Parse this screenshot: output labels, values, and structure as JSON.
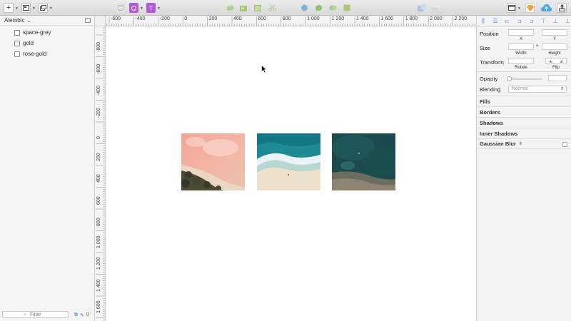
{
  "toolbar": {
    "insert_icon": "plus-icon",
    "group_icon": "artboard-icon",
    "layers_icon": "layers-icon",
    "colors": {
      "accent_purple": "#b05ad6",
      "green": "#9dc26b",
      "blue": "#5fa6d9",
      "sketch_orange": "#f3a33a",
      "cloud_blue": "#4aa8e0"
    }
  },
  "pages": {
    "current": "Alembic",
    "layers": [
      {
        "label": "space-grey"
      },
      {
        "label": "gold"
      },
      {
        "label": "rose-gold"
      }
    ],
    "filter_placeholder": "Filter"
  },
  "ruler": {
    "h_ticks": [
      "-600",
      "-400",
      "-200",
      "0",
      "200",
      "400",
      "600",
      "800",
      "1 000",
      "1 200",
      "1 400",
      "1 600",
      "1 800",
      "2 000",
      "2 200"
    ],
    "v_ticks": [
      "-800",
      "-600",
      "-400",
      "-200",
      "0",
      "200",
      "400",
      "600",
      "800",
      "1 000",
      "1 200",
      "1 400",
      "1 600"
    ]
  },
  "artboards": [
    {
      "name": "rose-gold",
      "theme": "pink"
    },
    {
      "name": "gold",
      "theme": "sand"
    },
    {
      "name": "space-grey",
      "theme": "dark"
    }
  ],
  "inspector": {
    "position_label": "Position",
    "x_label": "X",
    "y_label": "Y",
    "size_label": "Size",
    "width_label": "Width",
    "height_label": "Height",
    "transform_label": "Transform",
    "rotate_label": "Rotate",
    "flip_label": "Flip",
    "opacity_label": "Opacity",
    "blending_label": "Blending",
    "blending_value": "Normal",
    "sections": [
      "Fills",
      "Borders",
      "Shadows",
      "Inner Shadows",
      "Gaussian Blur"
    ]
  }
}
